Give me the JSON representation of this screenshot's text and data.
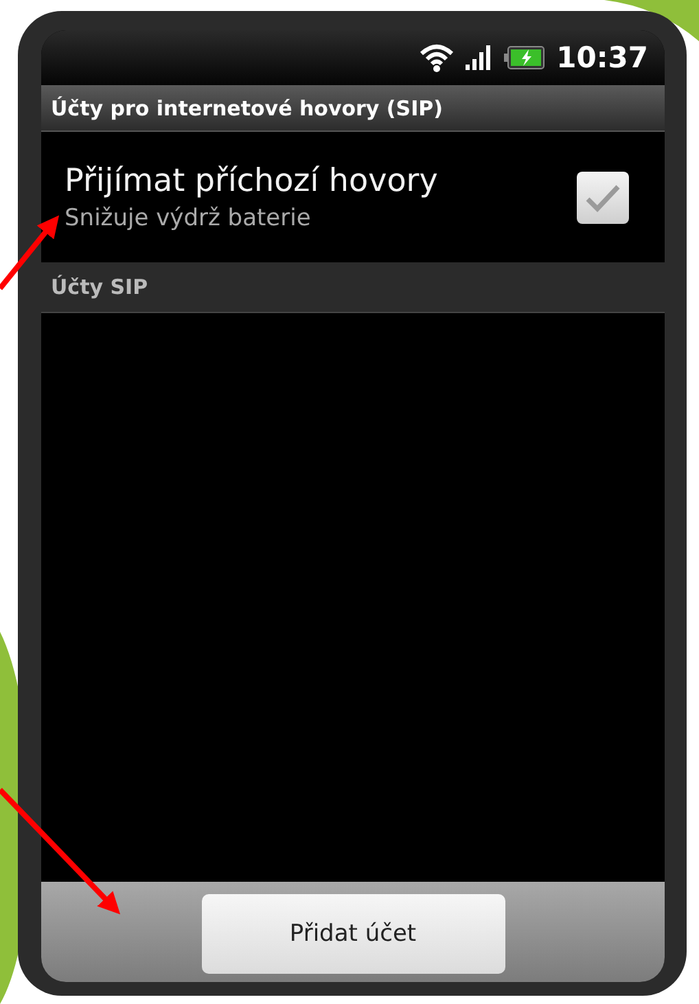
{
  "status_bar": {
    "time": "10:37"
  },
  "title_bar": {
    "title": "Účty pro internetové hovory (SIP)"
  },
  "settings": [
    {
      "title": "Přijímat příchozí hovory",
      "summary": "Snižuje výdrž baterie",
      "checked": true
    }
  ],
  "section_header": {
    "title": "Účty SIP"
  },
  "bottom_bar": {
    "button": "Přidat účet"
  }
}
